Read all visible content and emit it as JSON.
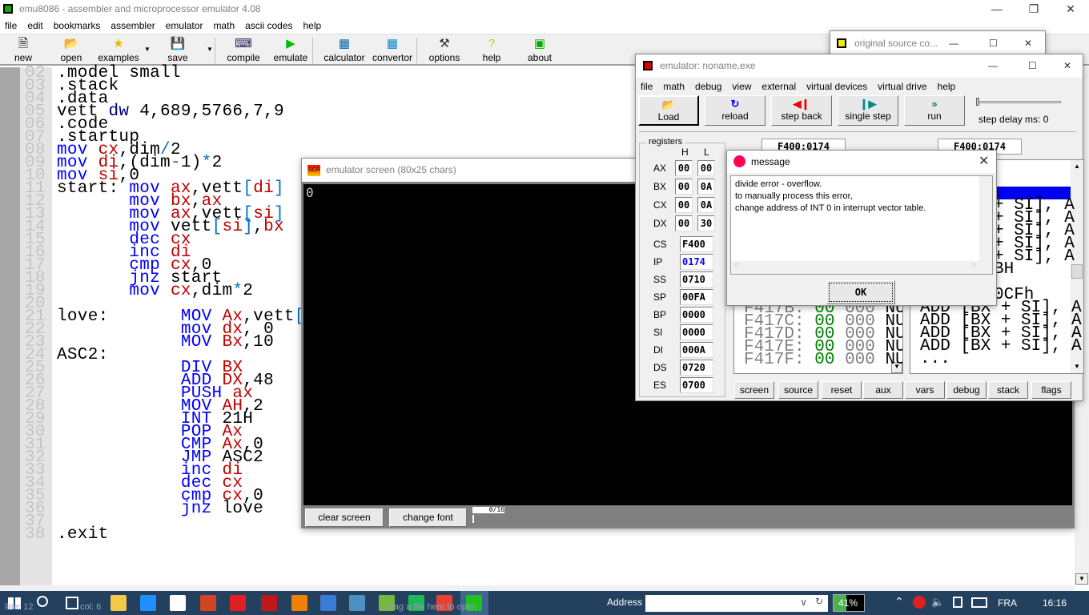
{
  "app": {
    "title": "emu8086 - assembler and microprocessor emulator 4.08",
    "menu": [
      "file",
      "edit",
      "bookmarks",
      "assembler",
      "emulator",
      "math",
      "ascii codes",
      "help"
    ],
    "toolbar": [
      {
        "label": "new",
        "icon": "new-file-icon"
      },
      {
        "label": "open",
        "icon": "open-folder-icon"
      },
      {
        "label": "examples",
        "icon": "star-icon"
      },
      {
        "label": "save",
        "icon": "floppy-icon"
      },
      {
        "label": "compile",
        "icon": "keyboard-icon"
      },
      {
        "label": "emulate",
        "icon": "play-icon"
      },
      {
        "label": "calculator",
        "icon": "calculator-icon"
      },
      {
        "label": "convertor",
        "icon": "convertor-icon"
      },
      {
        "label": "options",
        "icon": "tools-icon"
      },
      {
        "label": "help",
        "icon": "question-icon"
      },
      {
        "label": "about",
        "icon": "chip-icon"
      }
    ]
  },
  "editor": {
    "line_numbers": [
      "02",
      "03",
      "04",
      "05",
      "06",
      "07",
      "08",
      "09",
      "10",
      "11",
      "12",
      "13",
      "14",
      "15",
      "16",
      "17",
      "18",
      "19",
      "20",
      "21",
      "22",
      "23",
      "24",
      "25",
      "26",
      "27",
      "28",
      "29",
      "30",
      "31",
      "32",
      "33",
      "34",
      "35",
      "36",
      "37",
      "38"
    ],
    "lines": [
      [
        [
          "",
          ".model small"
        ]
      ],
      [
        [
          "",
          ".stack"
        ]
      ],
      [
        [
          "",
          ".data"
        ]
      ],
      [
        [
          "",
          "vett "
        ],
        [
          "n",
          "dw"
        ],
        [
          "",
          " 4,689,5766,7,9"
        ]
      ],
      [
        [
          "",
          ".code"
        ]
      ],
      [
        [
          "",
          ".startup"
        ]
      ],
      [
        [
          "k",
          "mov"
        ],
        [
          "",
          " "
        ],
        [
          "r",
          "cx"
        ],
        [
          "",
          ",dim"
        ],
        [
          "o",
          "/"
        ],
        [
          "",
          "2"
        ]
      ],
      [
        [
          "k",
          "mov"
        ],
        [
          "",
          " "
        ],
        [
          "r",
          "di"
        ],
        [
          "",
          ",(dim"
        ],
        [
          "o",
          "-"
        ],
        [
          "",
          "1)"
        ],
        [
          "o",
          "*"
        ],
        [
          "",
          "2"
        ]
      ],
      [
        [
          "k",
          "mov"
        ],
        [
          "",
          " "
        ],
        [
          "r",
          "si"
        ],
        [
          "",
          ",0"
        ]
      ],
      [
        [
          "",
          "start: "
        ],
        [
          "k",
          "mov"
        ],
        [
          "",
          " "
        ],
        [
          "r",
          "ax"
        ],
        [
          "",
          ",vett"
        ],
        [
          "o",
          "["
        ],
        [
          "r",
          "di"
        ],
        [
          "o",
          "]"
        ]
      ],
      [
        [
          "",
          "       "
        ],
        [
          "k",
          "mov"
        ],
        [
          "",
          " "
        ],
        [
          "r",
          "bx"
        ],
        [
          "",
          ","
        ],
        [
          "r",
          "ax"
        ]
      ],
      [
        [
          "",
          "       "
        ],
        [
          "k",
          "mov"
        ],
        [
          "",
          " "
        ],
        [
          "r",
          "ax"
        ],
        [
          "",
          ",vett"
        ],
        [
          "o",
          "["
        ],
        [
          "r",
          "si"
        ],
        [
          "o",
          "]"
        ]
      ],
      [
        [
          "",
          "       "
        ],
        [
          "k",
          "mov"
        ],
        [
          "",
          " vett"
        ],
        [
          "o",
          "["
        ],
        [
          "r",
          "si"
        ],
        [
          "o",
          "]"
        ],
        [
          "",
          ","
        ],
        [
          "r",
          "bx"
        ]
      ],
      [
        [
          "",
          "       "
        ],
        [
          "k",
          "dec"
        ],
        [
          "",
          " "
        ],
        [
          "r",
          "cx"
        ]
      ],
      [
        [
          "",
          "       "
        ],
        [
          "k",
          "inc"
        ],
        [
          "",
          " "
        ],
        [
          "r",
          "di"
        ]
      ],
      [
        [
          "",
          "       "
        ],
        [
          "k",
          "cmp"
        ],
        [
          "",
          " "
        ],
        [
          "r",
          "cx"
        ],
        [
          "",
          ",0"
        ]
      ],
      [
        [
          "",
          "       "
        ],
        [
          "k",
          "jnz"
        ],
        [
          "",
          " start"
        ]
      ],
      [
        [
          "",
          "       "
        ],
        [
          "k",
          "mov"
        ],
        [
          "",
          " "
        ],
        [
          "r",
          "cx"
        ],
        [
          "",
          ",dim"
        ],
        [
          "o",
          "*"
        ],
        [
          "",
          "2"
        ]
      ],
      [
        [
          "",
          ""
        ]
      ],
      [
        [
          "",
          "love:       "
        ],
        [
          "k",
          "MOV"
        ],
        [
          "",
          " "
        ],
        [
          "r",
          "Ax"
        ],
        [
          "",
          ",vett"
        ],
        [
          "o",
          "["
        ]
      ],
      [
        [
          "",
          "            "
        ],
        [
          "k",
          "mov"
        ],
        [
          "",
          " "
        ],
        [
          "r",
          "dx"
        ],
        [
          "",
          ", 0"
        ]
      ],
      [
        [
          "",
          "            "
        ],
        [
          "k",
          "MOV"
        ],
        [
          "",
          " "
        ],
        [
          "r",
          "Bx"
        ],
        [
          "",
          ",10"
        ]
      ],
      [
        [
          "",
          "ASC2:"
        ]
      ],
      [
        [
          "",
          "            "
        ],
        [
          "k",
          "DIV"
        ],
        [
          "",
          " "
        ],
        [
          "r",
          "BX"
        ]
      ],
      [
        [
          "",
          "            "
        ],
        [
          "k",
          "ADD"
        ],
        [
          "",
          " "
        ],
        [
          "r",
          "DX"
        ],
        [
          "",
          ",48"
        ]
      ],
      [
        [
          "",
          "            "
        ],
        [
          "k",
          "PUSH"
        ],
        [
          "",
          " "
        ],
        [
          "r",
          "ax"
        ]
      ],
      [
        [
          "",
          "            "
        ],
        [
          "k",
          "MOV"
        ],
        [
          "",
          " "
        ],
        [
          "r",
          "AH"
        ],
        [
          "",
          ",2"
        ]
      ],
      [
        [
          "",
          "            "
        ],
        [
          "k",
          "INT"
        ],
        [
          "",
          " 21H"
        ]
      ],
      [
        [
          "",
          "            "
        ],
        [
          "k",
          "POP"
        ],
        [
          "",
          " "
        ],
        [
          "r",
          "Ax"
        ]
      ],
      [
        [
          "",
          "            "
        ],
        [
          "k",
          "CMP"
        ],
        [
          "",
          " "
        ],
        [
          "r",
          "Ax"
        ],
        [
          "",
          ",0"
        ]
      ],
      [
        [
          "",
          "            "
        ],
        [
          "k",
          "JMP"
        ],
        [
          "",
          " ASC2"
        ]
      ],
      [
        [
          "",
          "            "
        ],
        [
          "k",
          "inc"
        ],
        [
          "",
          " "
        ],
        [
          "r",
          "di"
        ]
      ],
      [
        [
          "",
          "            "
        ],
        [
          "k",
          "dec"
        ],
        [
          "",
          " "
        ],
        [
          "r",
          "cx"
        ]
      ],
      [
        [
          "",
          "            "
        ],
        [
          "k",
          "cmp"
        ],
        [
          "",
          " "
        ],
        [
          "r",
          "cx"
        ],
        [
          "",
          ",0"
        ]
      ],
      [
        [
          "",
          "            "
        ],
        [
          "k",
          "jnz"
        ],
        [
          "",
          " love"
        ]
      ],
      [
        [
          "",
          ""
        ]
      ],
      [
        [
          "",
          ".exit"
        ]
      ]
    ]
  },
  "status": {
    "line": "line: 12",
    "col": "col: 6",
    "drag": "drag a file here to open"
  },
  "source_window": {
    "title": "original source co..."
  },
  "emulator": {
    "title": "emulator: noname.exe",
    "menu": [
      "file",
      "math",
      "debug",
      "view",
      "external",
      "virtual devices",
      "virtual drive",
      "help"
    ],
    "buttons": [
      "Load",
      "reload",
      "step back",
      "single step",
      "run"
    ],
    "step_delay": "step delay ms: 0",
    "step_delay_value": 0,
    "registers_label": "registers",
    "h": "H",
    "l": "L",
    "gp": [
      {
        "n": "AX",
        "h": "00",
        "l": "00"
      },
      {
        "n": "BX",
        "h": "00",
        "l": "0A"
      },
      {
        "n": "CX",
        "h": "00",
        "l": "0A"
      },
      {
        "n": "DX",
        "h": "00",
        "l": "30"
      }
    ],
    "seg": [
      {
        "n": "CS",
        "v": "F400"
      },
      {
        "n": "IP",
        "v": "0174"
      },
      {
        "n": "SS",
        "v": "0710"
      },
      {
        "n": "SP",
        "v": "00FA"
      },
      {
        "n": "BP",
        "v": "0000"
      },
      {
        "n": "SI",
        "v": "0000"
      },
      {
        "n": "DI",
        "v": "000A"
      },
      {
        "n": "DS",
        "v": "0720"
      },
      {
        "n": "ES",
        "v": "0700"
      }
    ],
    "addr1": "F400:0174",
    "addr2": "F400:0174",
    "memory": [
      {
        "a": "F417B:",
        "h": "00",
        "d": "000",
        "c": "NU"
      },
      {
        "a": "F417C:",
        "h": "00",
        "d": "000",
        "c": "NU"
      },
      {
        "a": "F417D:",
        "h": "00",
        "d": "000",
        "c": "NU"
      },
      {
        "a": "F417E:",
        "h": "00",
        "d": "000",
        "c": "NU"
      },
      {
        "a": "F417F:",
        "h": "00",
        "d": "000",
        "c": "NU"
      }
    ],
    "disasm_partial": [
      "+ SI], A",
      "+ SI], A",
      "+ SI], A",
      "+ SI], A",
      "+ SI], A",
      "BH",
      "",
      "0CFh"
    ],
    "disasm": [
      "ADD [BX + SI], A",
      "ADD [BX + SI], A",
      "ADD [BX + SI], A",
      "ADD [BX + SI], A",
      "..."
    ],
    "bottom": [
      "screen",
      "source",
      "reset",
      "aux",
      "vars",
      "debug",
      "stack",
      "flags"
    ]
  },
  "screen_window": {
    "title": "emulator screen (80x25 chars)",
    "content": "0",
    "clear": "clear screen",
    "font": "change font",
    "page": "0/16"
  },
  "message": {
    "title": "message",
    "lines": [
      "divide error - overflow.",
      "to manually process this error,",
      "change address of INT 0 in interrupt vector table."
    ],
    "ok": "OK"
  },
  "taskbar": {
    "address_label": "Address",
    "battery": "41%",
    "battery_level": 41,
    "lang": "FRA",
    "time": "16:16",
    "apps": [
      {
        "icon": "file-explorer-icon",
        "color": "#f4c84a"
      },
      {
        "icon": "edge-icon",
        "color": "#1e90ff"
      },
      {
        "icon": "store-icon",
        "color": "#ffffff"
      },
      {
        "icon": "powerpoint-icon",
        "color": "#d04423"
      },
      {
        "icon": "mail-icon",
        "color": "#e02020"
      },
      {
        "icon": "mcafee-icon",
        "color": "#c01818"
      },
      {
        "icon": "vlc-icon",
        "color": "#f08000"
      },
      {
        "icon": "app-icon",
        "color": "#3a7bd5"
      },
      {
        "icon": "app2-icon",
        "color": "#4a90c0"
      },
      {
        "icon": "utorrent-icon",
        "color": "#76b83f"
      },
      {
        "icon": "spotify-icon",
        "color": "#1db954"
      },
      {
        "icon": "chrome-icon",
        "color": "#e94235"
      },
      {
        "icon": "emu8086-icon",
        "color": "#20c020"
      }
    ]
  }
}
